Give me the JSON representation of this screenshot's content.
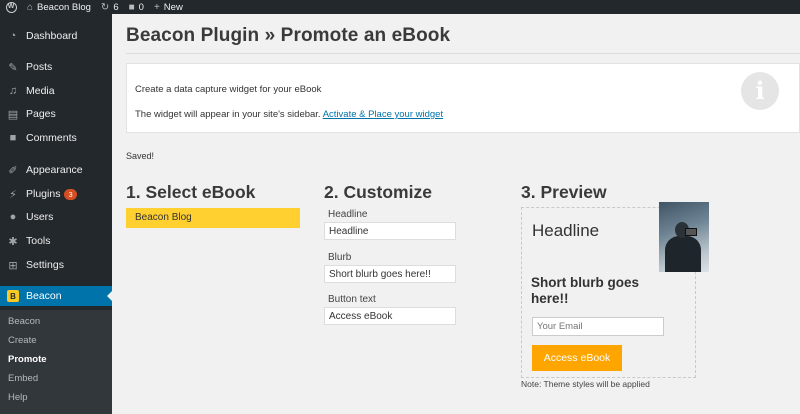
{
  "admin_bar": {
    "wp_icon": "wordpress-icon",
    "site_name": "Beacon Blog",
    "updates_count": "6",
    "comments_count": "0",
    "new_label": "New"
  },
  "sidebar": {
    "items": [
      {
        "label": "Dashboard",
        "icon": "dashboard-icon"
      },
      {
        "label": "Posts",
        "icon": "pin-icon"
      },
      {
        "label": "Media",
        "icon": "media-icon"
      },
      {
        "label": "Pages",
        "icon": "pages-icon"
      },
      {
        "label": "Comments",
        "icon": "comment-icon"
      },
      {
        "label": "Appearance",
        "icon": "brush-icon"
      },
      {
        "label": "Plugins",
        "icon": "plug-icon",
        "badge": "3"
      },
      {
        "label": "Users",
        "icon": "user-icon"
      },
      {
        "label": "Tools",
        "icon": "wrench-icon"
      },
      {
        "label": "Settings",
        "icon": "settings-icon"
      },
      {
        "label": "Beacon",
        "icon": "beacon-icon"
      }
    ],
    "submenu": [
      "Beacon",
      "Create",
      "Promote",
      "Embed",
      "Help"
    ]
  },
  "page": {
    "title": "Beacon Plugin » Promote an eBook",
    "notice_line1": "Create a data capture widget for your eBook",
    "notice_line2_text": "The widget will appear in your site's sidebar.",
    "notice_link": "Activate & Place your widget",
    "saved_text": "Saved!"
  },
  "columns": {
    "select_heading": "1. Select eBook",
    "customize_heading": "2. Customize",
    "preview_heading": "3. Preview"
  },
  "select": {
    "selected_ebook": "Beacon Blog"
  },
  "customize": {
    "headline_label": "Headline",
    "headline_value": "Headline",
    "blurb_label": "Blurb",
    "blurb_value": "Short blurb goes here!!",
    "button_label": "Button text",
    "button_value": "Access eBook"
  },
  "preview": {
    "headline": "Headline",
    "blurb": "Short blurb goes here!!",
    "email_placeholder": "Your Email",
    "button": "Access eBook",
    "note": "Note: Theme styles will be applied"
  },
  "colors": {
    "sidebar_bg": "#23282d",
    "active_blue": "#0073aa",
    "ebook_yellow": "#ffd02f",
    "button_orange": "#ffa500"
  }
}
